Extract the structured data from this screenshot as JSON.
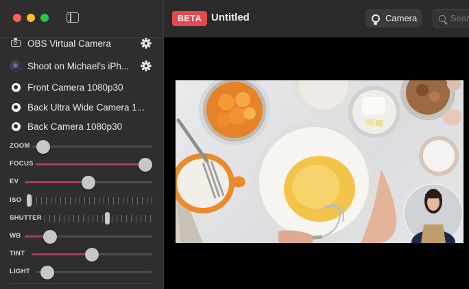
{
  "window": {
    "sidebar_toggle_icon": "sidebar-toggle-icon"
  },
  "sidebar": {
    "sources": [
      {
        "label": "OBS Virtual Camera",
        "icon": "camera-icon",
        "has_settings": true
      },
      {
        "label": "Shoot on Michael's iPh...",
        "icon": "phone-camera-icon",
        "has_settings": true
      },
      {
        "label": "Front Camera 1080p30",
        "icon": "radio-icon",
        "has_settings": false
      },
      {
        "label": "Back Ultra Wide Camera 1...",
        "icon": "radio-icon",
        "has_settings": false
      },
      {
        "label": "Back Camera 1080p30",
        "icon": "radio-icon",
        "has_settings": false
      }
    ],
    "controls": [
      {
        "label": "ZOOM",
        "type": "slider",
        "value": 0.1
      },
      {
        "label": "FOCUS",
        "type": "slider",
        "value": 1.0
      },
      {
        "label": "EV",
        "type": "slider",
        "value": 0.5
      },
      {
        "label": "ISO",
        "type": "ticks",
        "value": 0.0
      },
      {
        "label": "SHUTTER",
        "type": "ticks",
        "value": 0.58
      },
      {
        "label": "WB",
        "type": "slider",
        "value": 0.2
      },
      {
        "label": "TINT",
        "type": "slider",
        "value": 0.5
      },
      {
        "label": "LIGHT",
        "type": "slider",
        "value": 0.1
      }
    ]
  },
  "topbar": {
    "badge": "BETA",
    "title": "Untitled",
    "camera_button": "Camera",
    "search_placeholder": "Search"
  },
  "colors": {
    "accent_fill": "#b23a58",
    "beta_badge": "#e5484d"
  }
}
